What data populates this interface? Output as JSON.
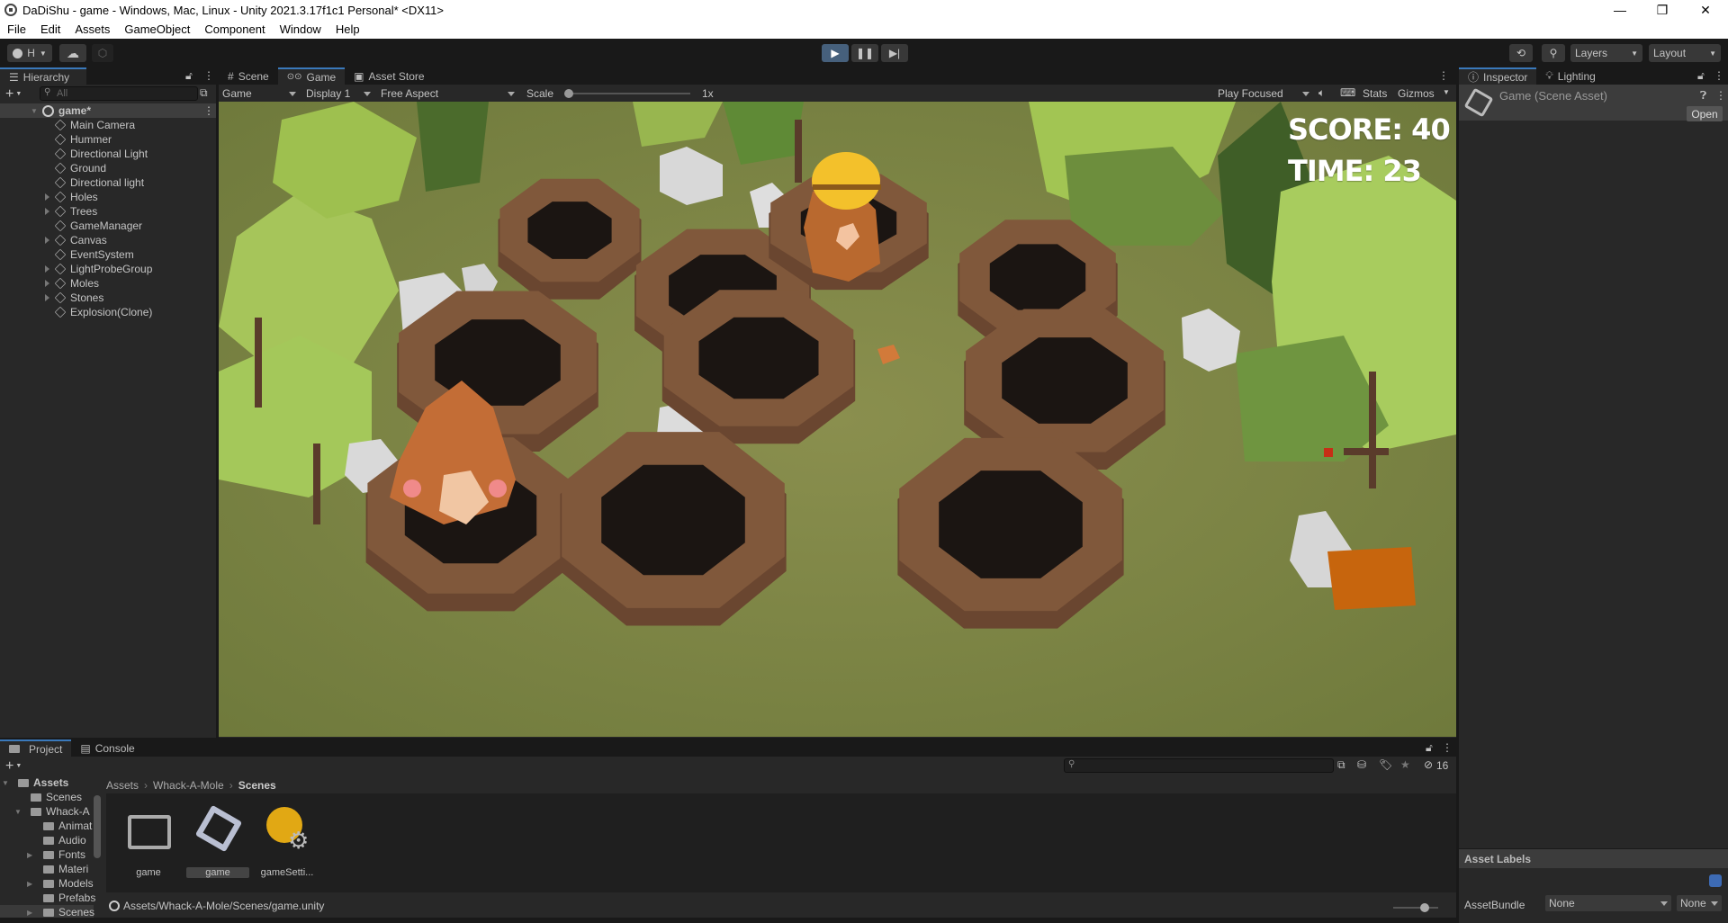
{
  "window": {
    "title": "DaDiShu - game - Windows, Mac, Linux - Unity 2021.3.17f1c1 Personal* <DX11>",
    "controls": {
      "minimize": "—",
      "restore": "❐",
      "close": "✕"
    }
  },
  "menu": [
    "File",
    "Edit",
    "Assets",
    "GameObject",
    "Component",
    "Window",
    "Help"
  ],
  "toolbar": {
    "account_label": "H",
    "play_state": "playing",
    "layers_label": "Layers",
    "layout_label": "Layout"
  },
  "hierarchy": {
    "tab_label": "Hierarchy",
    "search_placeholder": "All",
    "scene_name": "game*",
    "items": [
      {
        "label": "Main Camera",
        "expandable": false
      },
      {
        "label": "Hummer",
        "expandable": false
      },
      {
        "label": "Directional Light",
        "expandable": false
      },
      {
        "label": "Ground",
        "expandable": false
      },
      {
        "label": "Directional light",
        "expandable": false
      },
      {
        "label": "Holes",
        "expandable": true
      },
      {
        "label": "Trees",
        "expandable": true
      },
      {
        "label": "GameManager",
        "expandable": false
      },
      {
        "label": "Canvas",
        "expandable": true
      },
      {
        "label": "EventSystem",
        "expandable": false
      },
      {
        "label": "LightProbeGroup",
        "expandable": true
      },
      {
        "label": "Moles",
        "expandable": true
      },
      {
        "label": "Stones",
        "expandable": true
      },
      {
        "label": "Explosion(Clone)",
        "expandable": false
      }
    ]
  },
  "center": {
    "tabs": [
      {
        "label": "Scene",
        "icon": "#"
      },
      {
        "label": "Game",
        "icon": "🎮",
        "active": true
      },
      {
        "label": "Asset Store",
        "icon": "🔒"
      }
    ],
    "game_toolbar": {
      "view_select": "Game",
      "display_select": "Display 1",
      "aspect_select": "Free Aspect",
      "scale_label": "Scale",
      "scale_value": "1x",
      "scale_fraction": 0,
      "play_mode_select": "Play Focused",
      "stats_label": "Stats",
      "gizmos_label": "Gizmos"
    },
    "hud": {
      "score": "SCORE: 40",
      "time": "TIME: 23"
    }
  },
  "inspector": {
    "tabs": [
      {
        "label": "Inspector",
        "active": true
      },
      {
        "label": "Lighting"
      }
    ],
    "asset_title": "Game (Scene Asset)",
    "open_button": "Open",
    "asset_labels_title": "Asset Labels",
    "asset_bundle_label": "AssetBundle",
    "asset_bundle_value": "None",
    "asset_bundle_variant": "None"
  },
  "project": {
    "tabs": [
      {
        "label": "Project",
        "active": true
      },
      {
        "label": "Console"
      }
    ],
    "tree": [
      {
        "label": "Assets",
        "level": 0,
        "bold": true,
        "open": true
      },
      {
        "label": "Scenes",
        "level": 1
      },
      {
        "label": "Whack-A",
        "level": 1,
        "open": true
      },
      {
        "label": "Animat",
        "level": 2
      },
      {
        "label": "Audio",
        "level": 2
      },
      {
        "label": "Fonts",
        "level": 2,
        "expandable": true
      },
      {
        "label": "Materi",
        "level": 2
      },
      {
        "label": "Models",
        "level": 2,
        "expandable": true
      },
      {
        "label": "Prefabs",
        "level": 2
      },
      {
        "label": "Scenes",
        "level": 2,
        "expandable": true,
        "selected": true
      }
    ],
    "breadcrumb": [
      "Assets",
      "Whack-A-Mole",
      "Scenes"
    ],
    "assets": [
      {
        "label": "game",
        "type": "folder"
      },
      {
        "label": "game",
        "type": "scene",
        "selected": true
      },
      {
        "label": "gameSetti...",
        "type": "lighting-settings"
      }
    ],
    "hidden_count": "16",
    "path": "Assets/Whack-A-Mole/Scenes/game.unity"
  }
}
